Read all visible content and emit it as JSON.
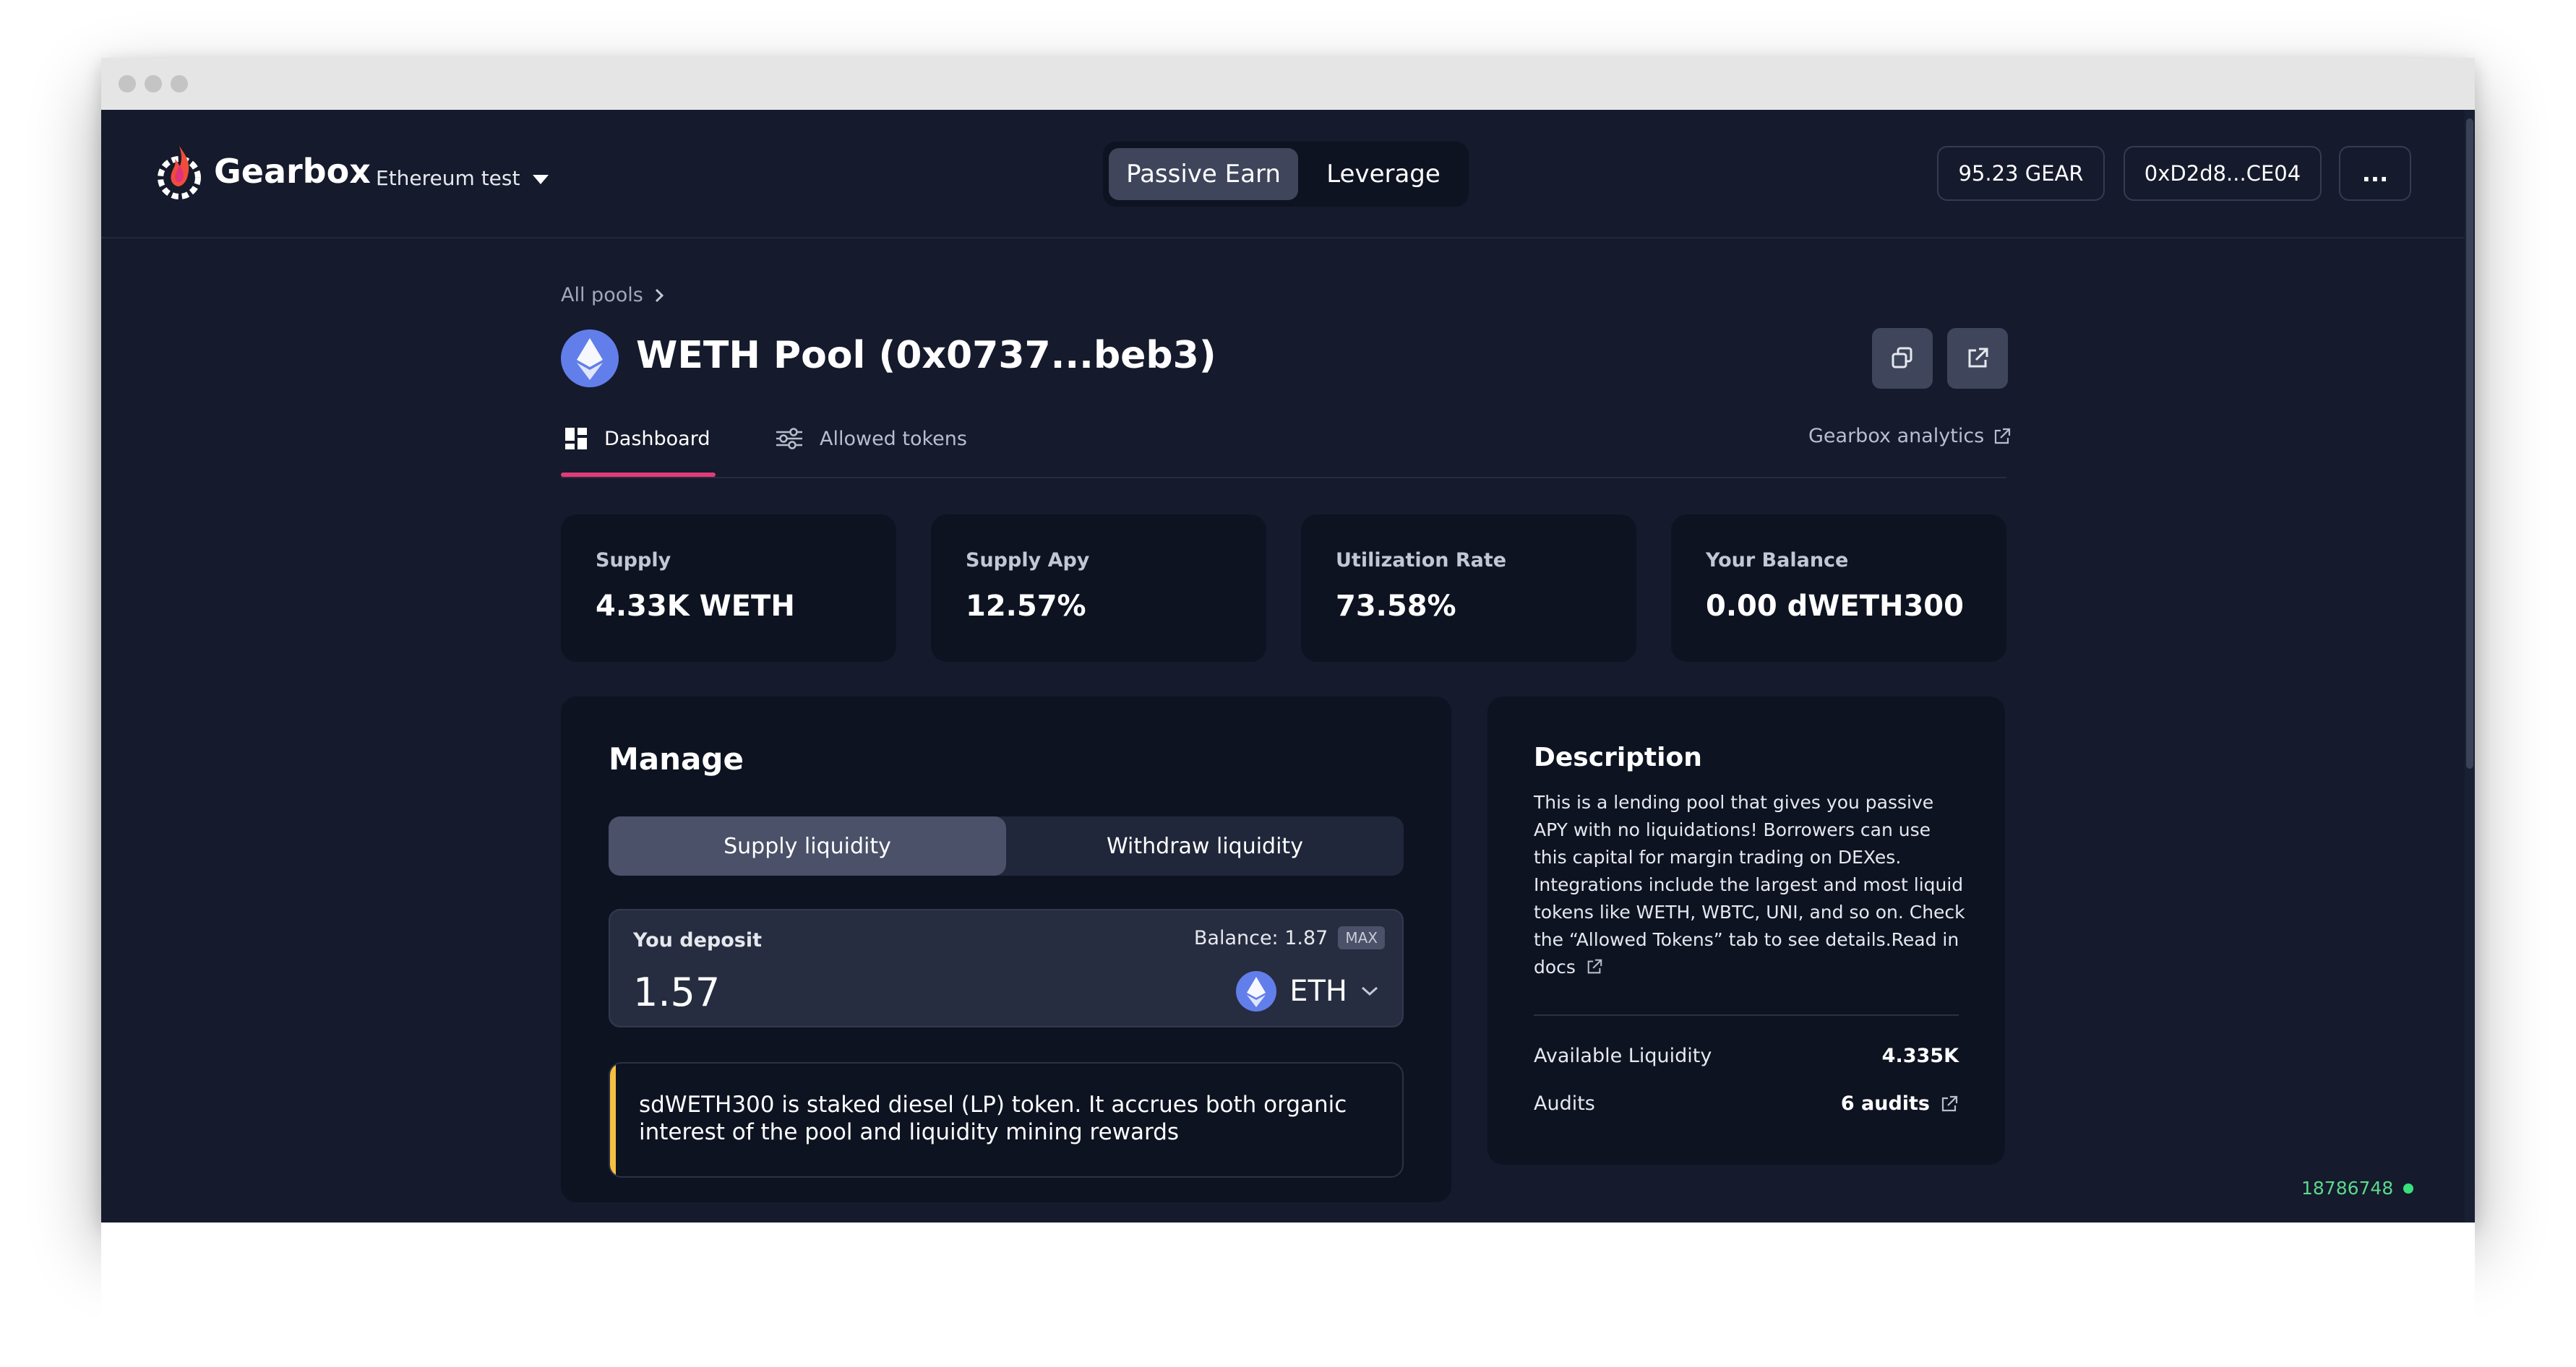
{
  "header": {
    "brand": "Gearbox",
    "network": "Ethereum test",
    "mode_tabs": [
      "Passive Earn",
      "Leverage"
    ],
    "gear_balance": "95.23 GEAR",
    "wallet": "0xD2d8...CE04",
    "more_label": "...",
    "colors": {
      "accent_pink": "#e13b7a",
      "active_tab": "#3f465c"
    }
  },
  "breadcrumb": {
    "label": "All pools"
  },
  "pool": {
    "title": "WETH Pool (0x0737...beb3)",
    "icon": "eth-icon"
  },
  "tabs": [
    {
      "label": "Dashboard",
      "icon": "dashboard-icon",
      "active": true
    },
    {
      "label": "Allowed tokens",
      "icon": "sliders-icon",
      "active": false
    }
  ],
  "analytics_link": "Gearbox analytics",
  "stats": [
    {
      "label": "Supply",
      "value": "4.33K WETH"
    },
    {
      "label": "Supply Apy",
      "value": "12.57%"
    },
    {
      "label": "Utilization Rate",
      "value": "73.58%"
    },
    {
      "label": "Your Balance",
      "value": "0.00 dWETH300"
    }
  ],
  "manage": {
    "title": "Manage",
    "segments": [
      "Supply liquidity",
      "Withdraw liquidity"
    ],
    "deposit_label": "You deposit",
    "balance": "Balance: 1.87",
    "max_label": "MAX",
    "amount": "1.57",
    "token": "ETH",
    "note": "sdWETH300 is staked diesel (LP) token. It accrues both organic interest of the pool and liquidity mining rewards"
  },
  "description": {
    "title": "Description",
    "text": "This is a lending pool that gives you passive APY with no liquidations! Borrowers can use this capital for margin trading on DEXes. Integrations include the largest and most liquid tokens like WETH, WBTC, UNI, and so on. Check the “Allowed Tokens” tab to see details.Read in docs",
    "rows": [
      {
        "label": "Available Liquidity",
        "value": "4.335K"
      },
      {
        "label": "Audits",
        "value": "6 audits"
      }
    ]
  },
  "footer": {
    "block_number": "18786748"
  }
}
